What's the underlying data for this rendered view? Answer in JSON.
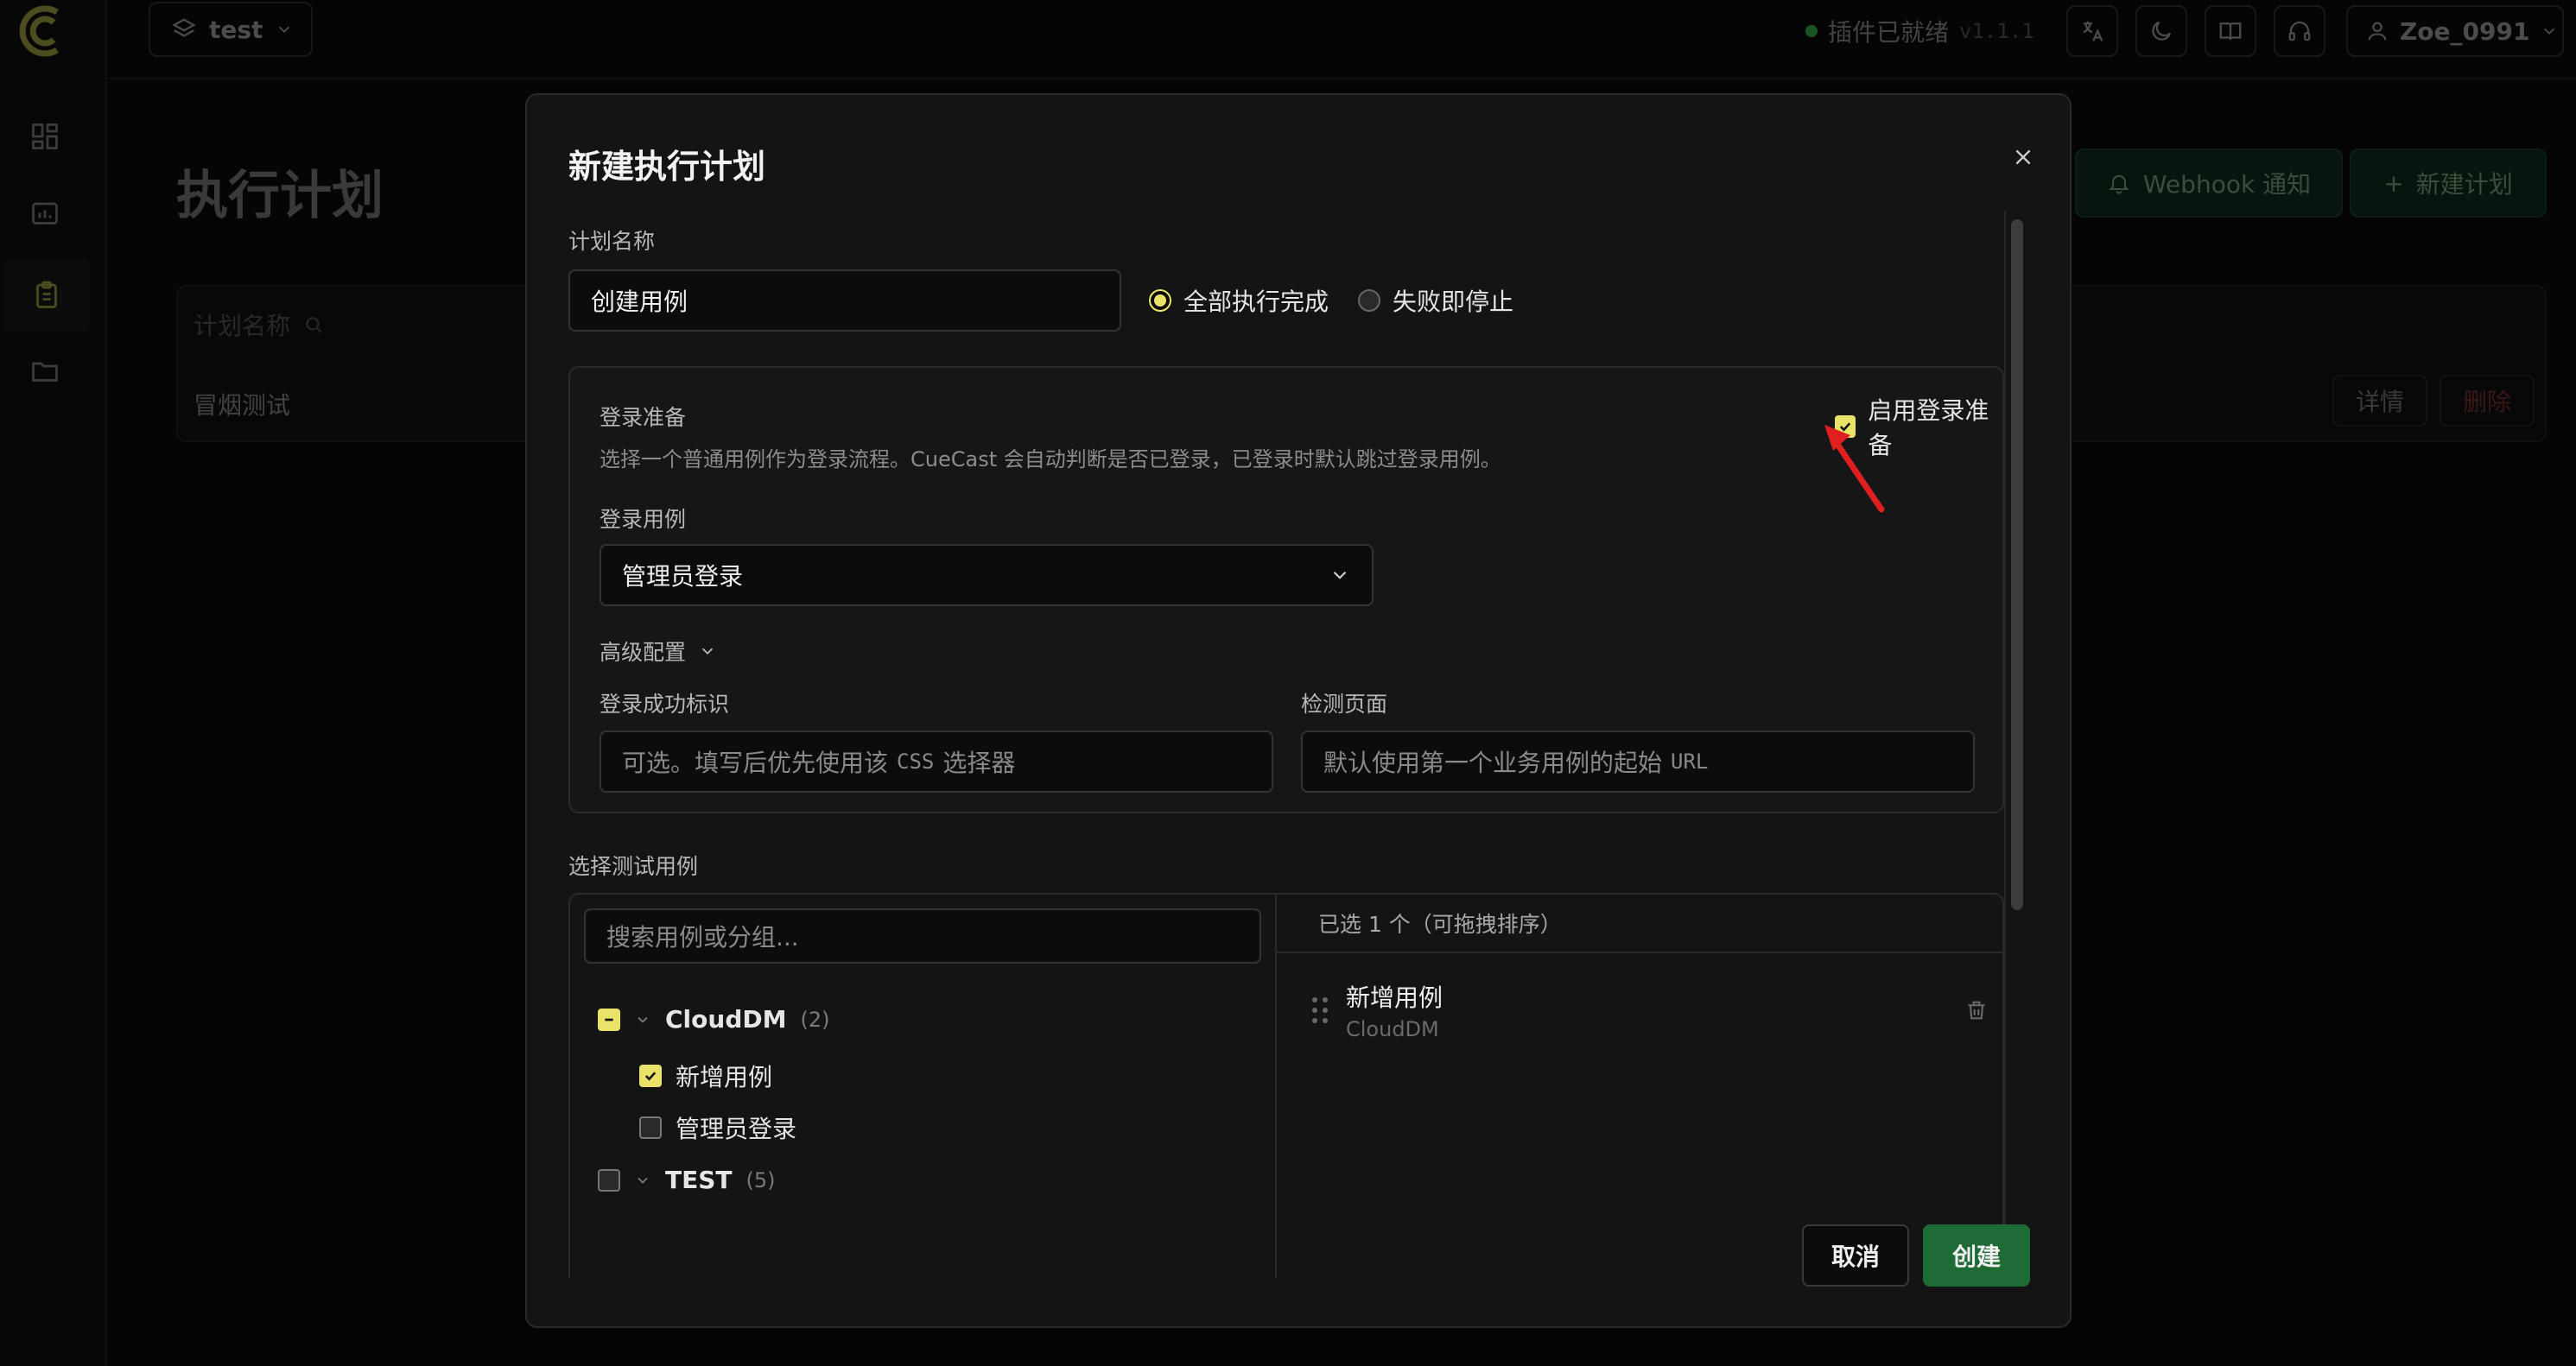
{
  "app": {
    "project_name": "test",
    "plugin_status": "插件已就绪",
    "plugin_version": "v1.1.1",
    "user_name": "Zoe_0991",
    "page_title": "执行计划",
    "webhook_button": "Webhook 通知",
    "new_plan_button": "新建计划",
    "table_header_name": "计划名称",
    "table_row_name": "冒烟测试",
    "row_detail_button": "详情",
    "row_delete_button": "删除",
    "accent_color": "#e9e36a",
    "primary_color": "#1f6b35",
    "danger_color": "#c43a3a"
  },
  "modal": {
    "title": "新建执行计划",
    "plan_name_label": "计划名称",
    "plan_name_value": "创建用例",
    "strategy_options": [
      {
        "label": "全部执行完成",
        "selected": true
      },
      {
        "label": "失败即停止",
        "selected": false
      }
    ],
    "login": {
      "title": "登录准备",
      "description": "选择一个普通用例作为登录流程。CueCast 会自动判断是否已登录，已登录时默认跳过登录用例。",
      "enable_label": "启用登录准备",
      "enabled": true,
      "case_label": "登录用例",
      "case_value": "管理员登录",
      "advanced_label": "高级配置",
      "success_marker_label": "登录成功标识",
      "success_marker_placeholder_cn": "可选。填写后优先使用该",
      "success_marker_placeholder_code": "CSS",
      "success_marker_placeholder_tail": "选择器",
      "detect_page_label": "检测页面",
      "detect_page_placeholder_cn": "默认使用第一个业务用例的起始",
      "detect_page_placeholder_code": "URL"
    },
    "cases": {
      "label": "选择测试用例",
      "search_placeholder": "搜索用例或分组...",
      "groups": [
        {
          "name": "CloudDM",
          "count": "(2)",
          "items": [
            {
              "name": "新增用例",
              "checked": true
            },
            {
              "name": "管理员登录",
              "checked": false
            }
          ]
        },
        {
          "name": "TEST",
          "count": "(5)"
        }
      ],
      "selected_header": "已选 1 个（可拖拽排序）",
      "selected_items": [
        {
          "name": "新增用例",
          "group": "CloudDM"
        }
      ]
    },
    "cancel_button": "取消",
    "create_button": "创建"
  }
}
